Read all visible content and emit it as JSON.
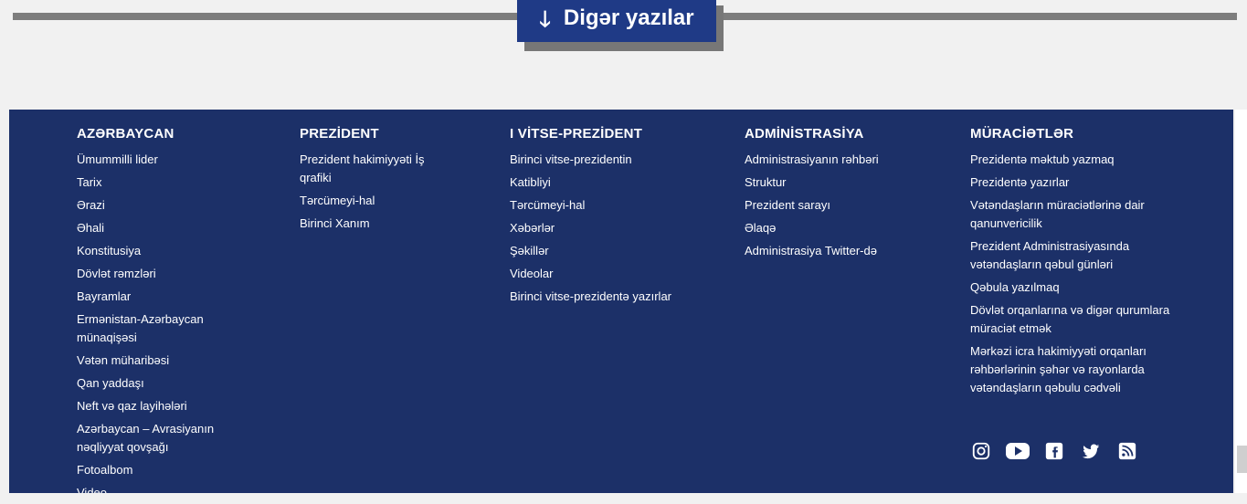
{
  "more_button": {
    "label": "Digər yazılar",
    "icon": "arrow-down-icon"
  },
  "footer": {
    "azerbaijan": {
      "title": "AZƏRBAYCAN",
      "items": [
        "Ümummilli lider",
        "Tarix",
        "Ərazi",
        "Əhali",
        "Konstitusiya",
        "Dövlət rəmzləri",
        "Bayramlar",
        "Ermənistan-Azərbaycan münaqişəsi",
        "Vətən müharibəsi",
        "Qan yaddaşı",
        "Neft və qaz layihələri",
        "Azərbaycan – Avrasiyanın nəqliyyat qovşağı",
        "Fotoalbom",
        "Video"
      ]
    },
    "president": {
      "title": "PREZİDENT",
      "items": [
        "Prezident hakimiyyəti İş qrafiki",
        "Tərcümeyi-hal",
        "Birinci Xanım"
      ]
    },
    "vice_president": {
      "title": "I VİTSE-PREZİDENT",
      "items": [
        "Birinci vitse-prezidentin",
        "Katibliyi",
        "Tərcümeyi-hal",
        "Xəbərlər",
        "Şəkillər",
        "Videolar",
        "Birinci vitse-prezidentə yazırlar"
      ]
    },
    "administration": {
      "title": "ADMİNİSTRASİYA",
      "items": [
        "Administrasiyanın rəhbəri",
        "Struktur",
        "Prezident sarayı",
        "Əlaqə",
        "Administrasiya Twitter-də"
      ]
    },
    "appeals": {
      "title": "MÜRACİƏTLƏR",
      "items": [
        "Prezidentə məktub yazmaq",
        "Prezidentə yazırlar",
        "Vətəndaşların müraciətlərinə dair qanunvericilik",
        "Prezident Administrasiyasında vətəndaşların qəbul günləri",
        "Qəbula yazılmaq",
        "Dövlət orqanlarına və digər qurumlara müraciət etmək",
        "Mərkəzi icra hakimiyyəti orqanları rəhbərlərinin şəhər və rayonlarda vətəndaşların qəbulu cədvəli"
      ]
    },
    "socials": [
      "instagram-icon",
      "youtube-icon",
      "facebook-icon",
      "twitter-icon",
      "rss-icon"
    ]
  },
  "colors": {
    "footer_bg": "#1c3068",
    "button_bg": "#1f3a86",
    "text": "#ffffff"
  }
}
